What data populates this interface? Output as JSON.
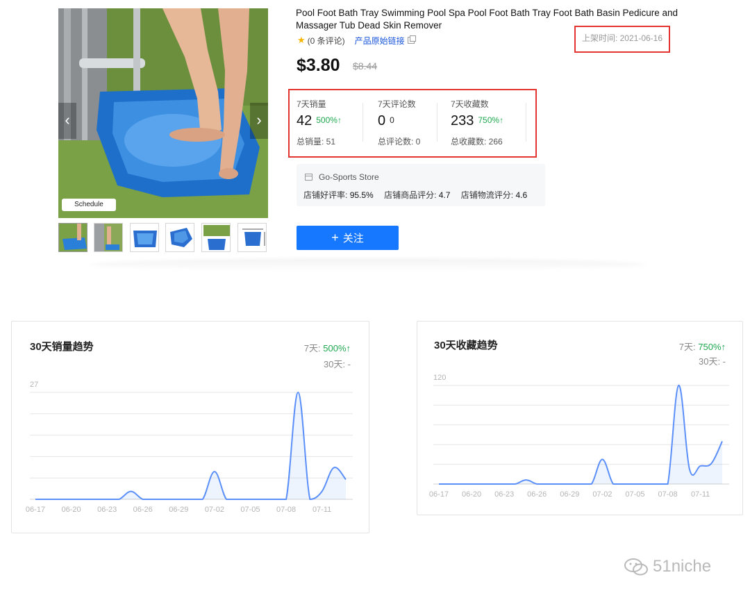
{
  "product": {
    "title": "Pool Foot Bath Tray Swimming Pool Spa Pool Foot Bath Tray Foot Bath Basin Pedicure and Massager Tub Dead Skin Remover",
    "rating_text": "(0 条评论)",
    "original_link": "产品原始链接",
    "launch_date": "上架时间: 2021-06-16",
    "price": "$3.80",
    "original_price": "$8.44",
    "image_badge": "Schedule",
    "icons": {
      "prev": "chevron-left-icon",
      "next": "chevron-right-icon",
      "star": "star-icon",
      "copy": "copy-icon",
      "store": "store-icon",
      "plus": "plus-icon"
    }
  },
  "stats": [
    {
      "label": "7天销量",
      "value": "42",
      "change": "500%↑",
      "total": "总销量: 51"
    },
    {
      "label": "7天评论数",
      "value": "0",
      "change": "0",
      "total": "总评论数: 0"
    },
    {
      "label": "7天收藏数",
      "value": "233",
      "change": "750%↑",
      "total": "总收藏数: 266"
    }
  ],
  "store": {
    "name": "Go-Sports Store",
    "positive_label": "店铺好评率:",
    "positive_value": "95.5%",
    "product_label": "店铺商品评分:",
    "product_value": "4.7",
    "logistics_label": "店铺物流评分:",
    "logistics_value": "4.6"
  },
  "follow_button": "关注",
  "charts": {
    "sales": {
      "title": "30天销量趋势",
      "seven_label": "7天:",
      "seven_value": "500%↑",
      "thirty": "30天: -"
    },
    "favorites": {
      "title": "30天收藏趋势",
      "seven_label": "7天:",
      "seven_value": "750%↑",
      "thirty": "30天: -"
    }
  },
  "chart_data": [
    {
      "type": "area",
      "title": "30天销量趋势",
      "x": [
        "06-17",
        "06-18",
        "06-19",
        "06-20",
        "06-21",
        "06-22",
        "06-23",
        "06-24",
        "06-25",
        "06-26",
        "06-27",
        "06-28",
        "06-29",
        "06-30",
        "07-01",
        "07-02",
        "07-03",
        "07-04",
        "07-05",
        "07-06",
        "07-07",
        "07-08",
        "07-09",
        "07-10",
        "07-11",
        "07-12",
        "07-13"
      ],
      "xticks": [
        "06-17",
        "06-20",
        "06-23",
        "06-26",
        "06-29",
        "07-02",
        "07-05",
        "07-08",
        "07-11"
      ],
      "series": [
        {
          "values": [
            0,
            0,
            0,
            0,
            0,
            0,
            0,
            0,
            2,
            0,
            0,
            0,
            0,
            0,
            0,
            7,
            0,
            0,
            0,
            0,
            0,
            0,
            27,
            0,
            2,
            8,
            5
          ]
        }
      ],
      "ylim": [
        0,
        27
      ],
      "ytick_label": "27",
      "grid": true,
      "color": "#5b8ff9"
    },
    {
      "type": "area",
      "title": "30天收藏趋势",
      "x": [
        "06-17",
        "06-18",
        "06-19",
        "06-20",
        "06-21",
        "06-22",
        "06-23",
        "06-24",
        "06-25",
        "06-26",
        "06-27",
        "06-28",
        "06-29",
        "06-30",
        "07-01",
        "07-02",
        "07-03",
        "07-04",
        "07-05",
        "07-06",
        "07-07",
        "07-08",
        "07-09",
        "07-10",
        "07-11",
        "07-12",
        "07-13"
      ],
      "xticks": [
        "06-17",
        "06-20",
        "06-23",
        "06-26",
        "06-29",
        "07-02",
        "07-05",
        "07-08",
        "07-11"
      ],
      "series": [
        {
          "values": [
            0,
            0,
            0,
            0,
            0,
            0,
            0,
            0,
            5,
            0,
            0,
            0,
            0,
            0,
            0,
            30,
            0,
            0,
            0,
            0,
            0,
            0,
            120,
            18,
            22,
            25,
            52
          ]
        }
      ],
      "ylim": [
        0,
        120
      ],
      "ytick_label": "120",
      "grid": true,
      "color": "#5b8ff9"
    }
  ],
  "watermark": "51niche"
}
